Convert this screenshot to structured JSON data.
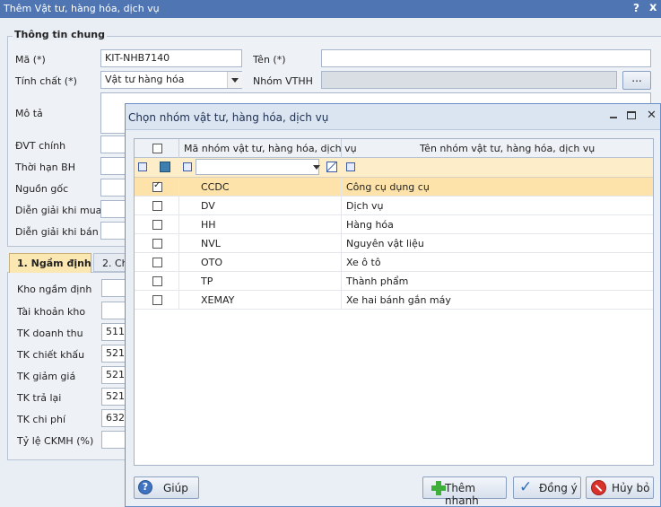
{
  "main": {
    "title": "Thêm Vật tư, hàng hóa, dịch vụ",
    "help_label": "?",
    "close_label": "x",
    "general_group_title": "Thông tin chung",
    "fields": {
      "ma_label": "Mã (*)",
      "ma_value": "KIT-NHB7140",
      "ten_label": "Tên (*)",
      "ten_value": "",
      "tinh_chat_label": "Tính chất (*)",
      "tinh_chat_value": "Vật tư hàng hóa",
      "nhom_vthh_label": "Nhóm VTHH",
      "nhom_vthh_button": "...",
      "mo_ta_label": "Mô tả",
      "dvt_label": "ĐVT chính",
      "thoi_han_label": "Thời hạn BH",
      "nguon_goc_label": "Nguồn gốc",
      "dien_giai_mua_label": "Diễn giải khi mua",
      "dien_giai_ban_label": "Diễn giải khi bán"
    },
    "tabs": [
      {
        "label": "1. Ngầm định"
      },
      {
        "label": "2. Ch"
      }
    ],
    "defaults": [
      {
        "label": "Kho ngầm định",
        "value": ""
      },
      {
        "label": "Tài khoản kho",
        "value": ""
      },
      {
        "label": "TK doanh thu",
        "value": "511"
      },
      {
        "label": "TK chiết khấu",
        "value": "521"
      },
      {
        "label": "TK giảm giá",
        "value": "521"
      },
      {
        "label": "TK trả lại",
        "value": "521"
      },
      {
        "label": "TK chi phí",
        "value": "632"
      },
      {
        "label": "Tỷ lệ CKMH (%)",
        "value": ""
      }
    ]
  },
  "dialog": {
    "title": "Chọn nhóm vật tư, hàng hóa, dịch vụ",
    "columns": {
      "code": "Mã nhóm vật tư, hàng hóa, dịch vụ",
      "name": "Tên nhóm vật tư, hàng hóa, dịch vụ"
    },
    "rows": [
      {
        "code": "CCDC",
        "name": "Công cụ dụng cụ",
        "checked": true,
        "selected": true
      },
      {
        "code": "DV",
        "name": "Dịch vụ",
        "checked": false,
        "selected": false
      },
      {
        "code": "HH",
        "name": "Hàng hóa",
        "checked": false,
        "selected": false
      },
      {
        "code": "NVL",
        "name": "Nguyên vật liệu",
        "checked": false,
        "selected": false
      },
      {
        "code": "OTO",
        "name": "Xe ô tô",
        "checked": false,
        "selected": false
      },
      {
        "code": "TP",
        "name": "Thành phẩm",
        "checked": false,
        "selected": false
      },
      {
        "code": "XEMAY",
        "name": "Xe hai bánh gắn máy",
        "checked": false,
        "selected": false
      }
    ],
    "buttons": {
      "help": "Giúp",
      "quick_add": "Thêm nhanh",
      "ok": "Đồng ý",
      "cancel": "Hủy bỏ"
    },
    "colors": {
      "selected_row": "#fde3a9",
      "title_bar": "#4f76b3",
      "accent": "#3b5aa8"
    }
  }
}
